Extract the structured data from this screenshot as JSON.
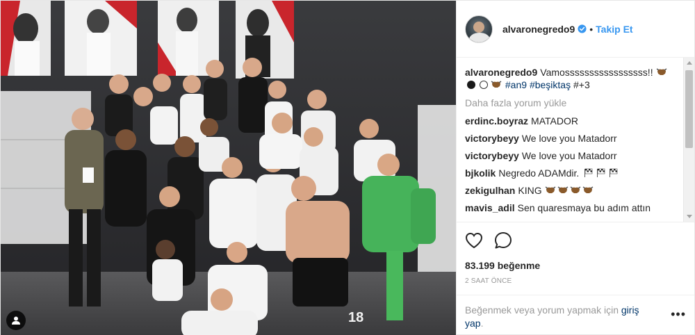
{
  "header": {
    "username": "alvaronegredo9",
    "follow_label": "Takip Et",
    "separator": "•"
  },
  "caption": {
    "username": "alvaronegredo9",
    "text": "Vamosssssssssssssssss!!",
    "tags": [
      "#an9",
      "#beşiktaş",
      "#+3"
    ]
  },
  "load_more": "Daha fazla yorum yükle",
  "comments": [
    {
      "user": "erdinc.boyraz",
      "text": "MATADOR"
    },
    {
      "user": "victorybeyy",
      "text": "We love you Matadorr"
    },
    {
      "user": "victorybeyy",
      "text": "We love you Matadorr"
    },
    {
      "user": "bjkolik",
      "text": "Negredo ADAMdir."
    },
    {
      "user": "zekigulhan",
      "text": "KING"
    },
    {
      "user": "mavis_adil",
      "text": "Sen quaresmaya bu adım attın"
    }
  ],
  "likes": "83.199 beğenme",
  "timestamp": "2 SAAT ÖNCE",
  "login": {
    "prompt": "Beğenmek veya yorum yapmak için",
    "link": "giriş yap",
    "link_part1": "giriş",
    "link_part2": "yap",
    "suffix": "."
  },
  "more": "•••",
  "icons": {
    "like": "heart-icon",
    "comment": "comment-icon",
    "verified": "verified-badge-icon",
    "tagged": "user-tag-icon",
    "bull": "bull-emoji-icon",
    "black_circle": "black-circle-emoji",
    "white_circle": "white-circle-emoji",
    "flag": "checkered-flag-emoji"
  },
  "colors": {
    "link_blue": "#3897f0",
    "tag_blue": "#003569",
    "muted": "#999999",
    "text": "#262626"
  }
}
